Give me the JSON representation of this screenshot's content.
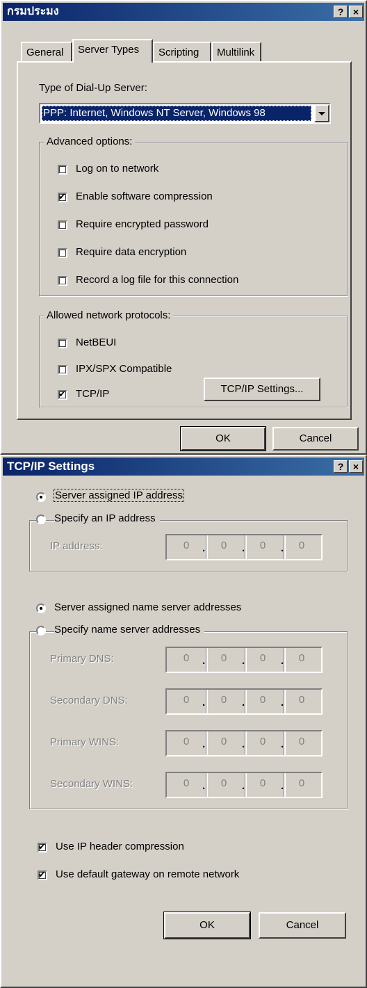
{
  "dialog1": {
    "title": "กรมประมง",
    "help_button": "?",
    "close_button": "×",
    "tabs": [
      "General",
      "Server Types",
      "Scripting",
      "Multilink"
    ],
    "server_type_label": "Type of Dial-Up Server:",
    "server_type_value": "PPP: Internet, Windows NT Server, Windows 98",
    "advanced_options_title": "Advanced options:",
    "advanced_options": [
      {
        "label": "Log on to network",
        "checked": false
      },
      {
        "label": "Enable software compression",
        "checked": true
      },
      {
        "label": "Require encrypted password",
        "checked": false
      },
      {
        "label": "Require data encryption",
        "checked": false
      },
      {
        "label": "Record a log file for this connection",
        "checked": false
      }
    ],
    "protocols_title": "Allowed network protocols:",
    "protocols": [
      {
        "label": "NetBEUI",
        "checked": false
      },
      {
        "label": "IPX/SPX Compatible",
        "checked": false
      },
      {
        "label": "TCP/IP",
        "checked": true
      }
    ],
    "tcpip_settings_button": "TCP/IP Settings...",
    "ok_button": "OK",
    "cancel_button": "Cancel"
  },
  "dialog2": {
    "title": "TCP/IP Settings",
    "help_button": "?",
    "close_button": "×",
    "server_assigned_ip": "Server assigned IP address",
    "specify_ip": "Specify an IP address",
    "ip_address_label": "IP address:",
    "server_assigned_ns": "Server assigned name server addresses",
    "specify_ns": "Specify name server addresses",
    "dns_fields": [
      {
        "label": "Primary DNS:"
      },
      {
        "label": "Secondary DNS:"
      },
      {
        "label": "Primary WINS:"
      },
      {
        "label": "Secondary WINS:"
      }
    ],
    "octet_value": "0",
    "octet_dot": ".",
    "use_ip_header_compression": "Use IP header compression",
    "use_default_gateway": "Use default gateway on remote network",
    "ok_button": "OK",
    "cancel_button": "Cancel"
  }
}
